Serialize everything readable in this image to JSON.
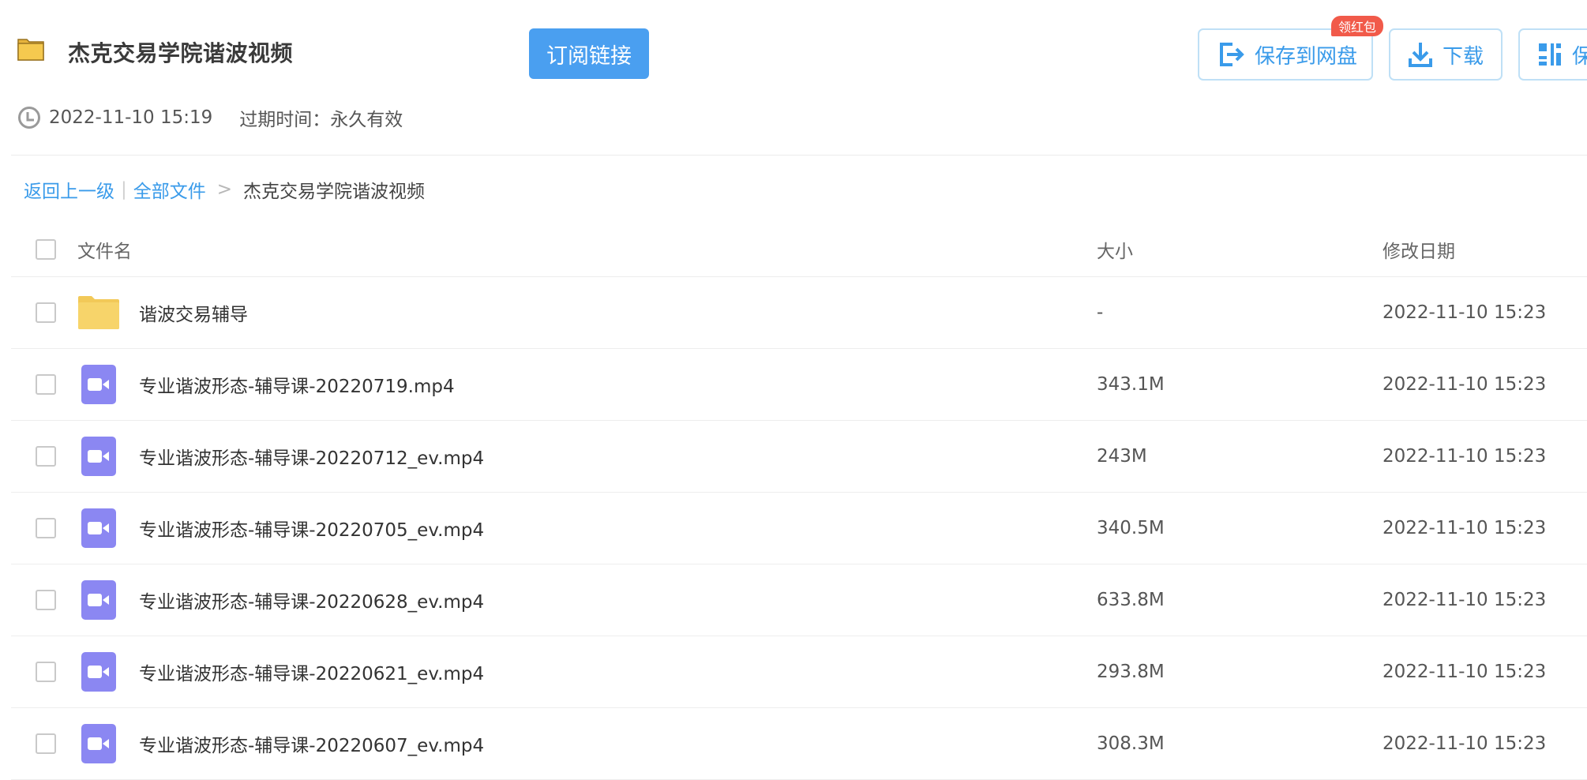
{
  "share": {
    "title": "杰克交易学院谐波视频",
    "subscribe_label": "订阅链接",
    "created": "2022-11-10 15:19",
    "expire_label": "过期时间：永久有效",
    "badge": "领红包"
  },
  "actions": {
    "save_label": "保存到网盘",
    "download_label": "下载",
    "more_label": "保"
  },
  "breadcrumb": {
    "back": "返回上一级",
    "sep": "|",
    "all_files": "全部文件",
    "arrow": ">",
    "current": "杰克交易学院谐波视频"
  },
  "table": {
    "headers": {
      "name": "文件名",
      "size": "大小",
      "date": "修改日期"
    },
    "rows": [
      {
        "type": "folder",
        "name": "谐波交易辅导",
        "size": "-",
        "date": "2022-11-10 15:23"
      },
      {
        "type": "video",
        "name": "专业谐波形态-辅导课-20220719.mp4",
        "size": "343.1M",
        "date": "2022-11-10 15:23"
      },
      {
        "type": "video",
        "name": "专业谐波形态-辅导课-20220712_ev.mp4",
        "size": "243M",
        "date": "2022-11-10 15:23"
      },
      {
        "type": "video",
        "name": "专业谐波形态-辅导课-20220705_ev.mp4",
        "size": "340.5M",
        "date": "2022-11-10 15:23"
      },
      {
        "type": "video",
        "name": "专业谐波形态-辅导课-20220628_ev.mp4",
        "size": "633.8M",
        "date": "2022-11-10 15:23"
      },
      {
        "type": "video",
        "name": "专业谐波形态-辅导课-20220621_ev.mp4",
        "size": "293.8M",
        "date": "2022-11-10 15:23"
      },
      {
        "type": "video",
        "name": "专业谐波形态-辅导课-20220607_ev.mp4",
        "size": "308.3M",
        "date": "2022-11-10 15:23"
      }
    ]
  },
  "colors": {
    "accent": "#4a9ff0",
    "video_icon": "#8b87f2",
    "folder": "#f7d46a",
    "badge": "#f15a4a"
  }
}
